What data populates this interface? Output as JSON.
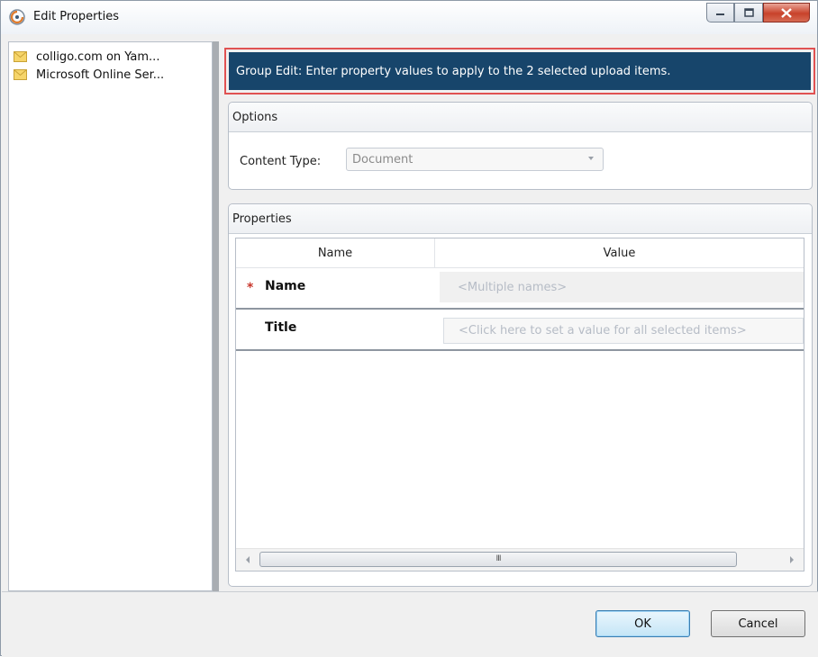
{
  "window": {
    "title": "Edit Properties",
    "controls": [
      "minimize-button",
      "maximize-button",
      "close-button"
    ]
  },
  "tree": {
    "items": [
      {
        "label": "colligo.com on Yam...",
        "icon": "envelope-icon"
      },
      {
        "label": "Microsoft Online Ser...",
        "icon": "envelope-icon"
      }
    ]
  },
  "banner": {
    "text": "Group Edit:  Enter property values to apply to the 2 selected upload items."
  },
  "options": {
    "header": "Options",
    "content_type_label": "Content Type:",
    "content_type_value": "Document"
  },
  "properties": {
    "header": "Properties",
    "columns": [
      "Name",
      "Value"
    ],
    "rows": [
      {
        "required": "*",
        "name": "Name",
        "value": "<Multiple names>"
      },
      {
        "required": "",
        "name": "Title",
        "value": "<Click here to set a value for all selected items>"
      }
    ],
    "scroll_thumb": "III"
  },
  "buttons": {
    "ok": "OK",
    "cancel": "Cancel"
  },
  "colors": {
    "banner_bg": "#17456b",
    "banner_border": "#e05252",
    "required_marker": "#c8362b"
  }
}
